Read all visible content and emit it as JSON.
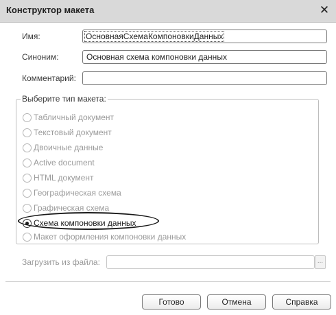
{
  "window": {
    "title": "Конструктор макета",
    "close_icon": "close-icon"
  },
  "fields": {
    "name_label": "Имя:",
    "name_value": "ОсновнаяСхемаКомпоновкиДанных",
    "synonym_label": "Синоним:",
    "synonym_value": "Основная схема компоновки данных",
    "comment_label": "Комментарий:",
    "comment_value": ""
  },
  "layout_type": {
    "legend": "Выберите тип макета:",
    "selected": "Схема компоновки данных",
    "options": [
      {
        "label": "Табличный документ",
        "checked": false
      },
      {
        "label": "Текстовый документ",
        "checked": false
      },
      {
        "label": "Двоичные данные",
        "checked": false
      },
      {
        "label": "Active document",
        "checked": false
      },
      {
        "label": "HTML документ",
        "checked": false
      },
      {
        "label": "Географическая схема",
        "checked": false
      },
      {
        "label": "Графическая схема",
        "checked": false
      },
      {
        "label": "Схема компоновки данных",
        "checked": true
      },
      {
        "label": "Макет оформления компоновки данных",
        "checked": false
      }
    ]
  },
  "file": {
    "label": "Загрузить из файла:",
    "value": "",
    "browse_label": "..."
  },
  "buttons": {
    "ok": "Готово",
    "cancel": "Отмена",
    "help": "Справка"
  }
}
